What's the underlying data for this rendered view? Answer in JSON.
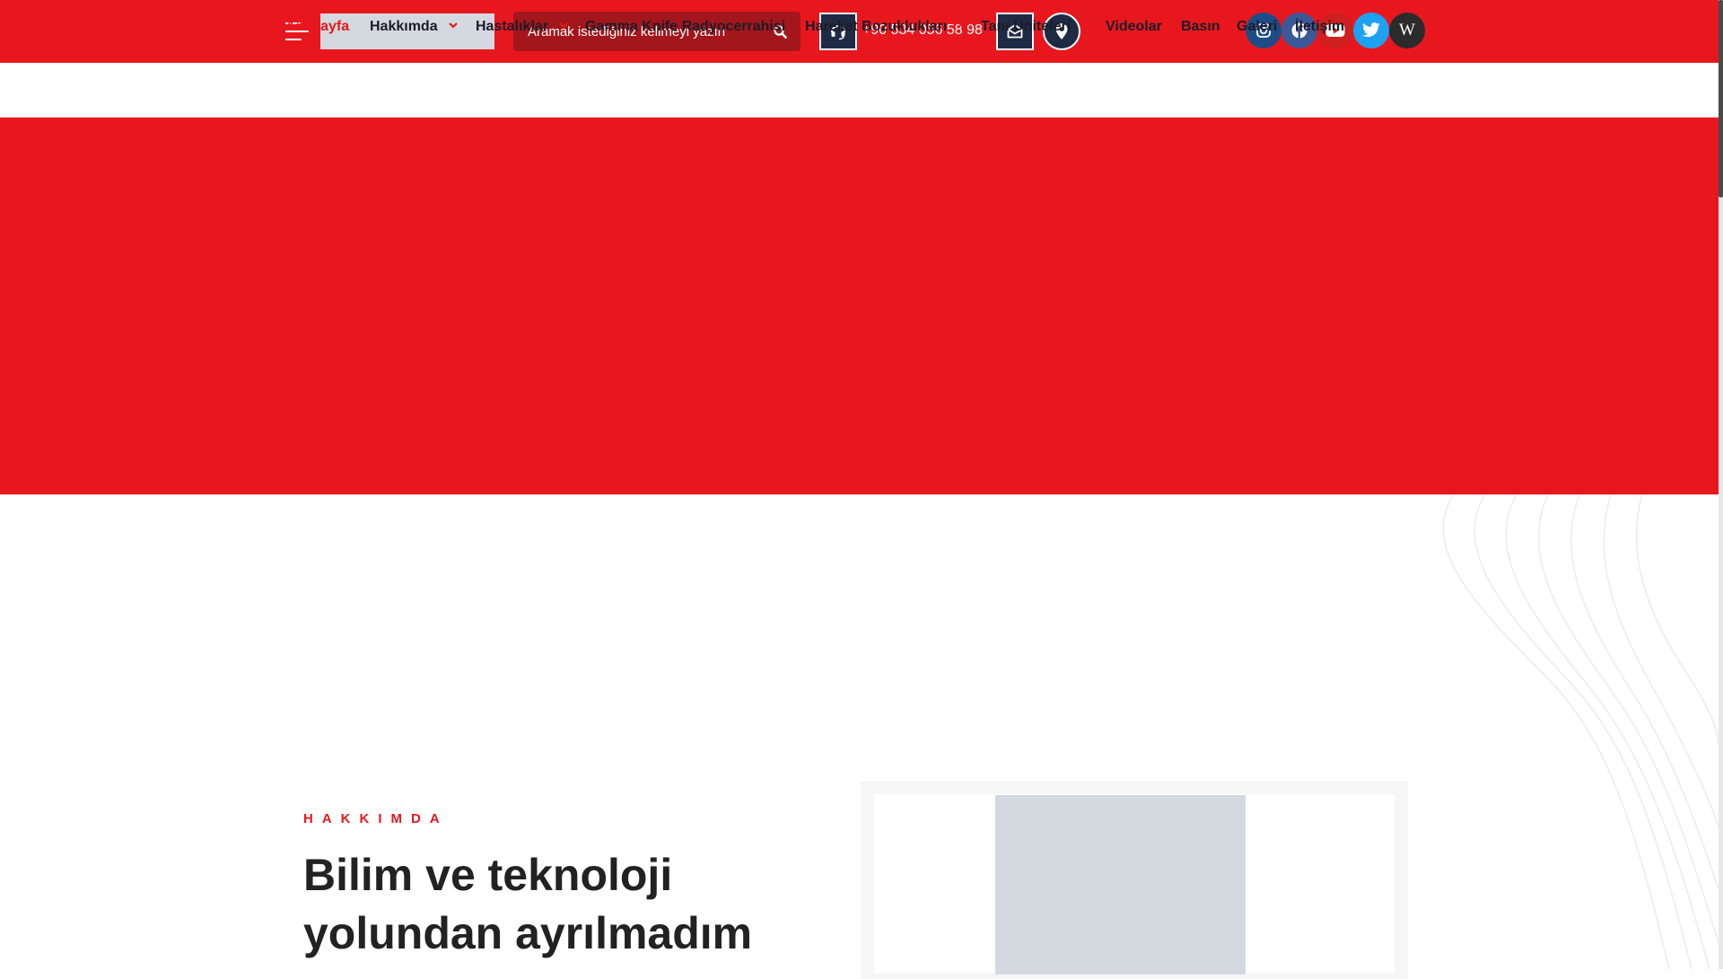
{
  "header": {
    "search": {
      "placeholder": "Aramak istediğiniz kelimeyi yazın"
    },
    "phone": "+90 534 056 58 98",
    "colors": {
      "brand_red": "#e8171e",
      "search_bg": "#a3161c",
      "icon_bg": "#1f2a44"
    },
    "contact_icons": [
      "headset-icon",
      "mail-icon",
      "map-pin-icon"
    ],
    "social": [
      {
        "name": "instagram",
        "icon": "instagram-icon",
        "color": "#1e4d86"
      },
      {
        "name": "facebook",
        "icon": "facebook-icon",
        "color": "#3b5998"
      },
      {
        "name": "youtube",
        "icon": "youtube-icon",
        "color": "#cd201f"
      },
      {
        "name": "twitter",
        "icon": "twitter-icon",
        "color": "#1da1f2"
      },
      {
        "name": "wikipedia",
        "icon": "wikipedia-icon",
        "label": "W",
        "color": "#2b2b2b"
      }
    ]
  },
  "nav": {
    "items": [
      {
        "label": "Anasayfa",
        "active": true
      },
      {
        "label": "Hakkımda",
        "dropdown": true
      },
      {
        "label": "Hastalıklar",
        "dropdown": true
      },
      {
        "label": "Gamma Knife Radyocerrahisi"
      },
      {
        "label": "Hareket Bozuklukları",
        "dropdown": true
      },
      {
        "label": "Tanı Üniteleri",
        "dropdown": true
      },
      {
        "label": "Videolar"
      },
      {
        "label": "Basın"
      },
      {
        "label": "Galeri"
      },
      {
        "label": "İletişim"
      }
    ]
  },
  "about": {
    "kicker": "HAKKIMDA",
    "title_line1": "Bilim ve teknoloji",
    "title_line2": "yolundan ayrılmadım"
  }
}
